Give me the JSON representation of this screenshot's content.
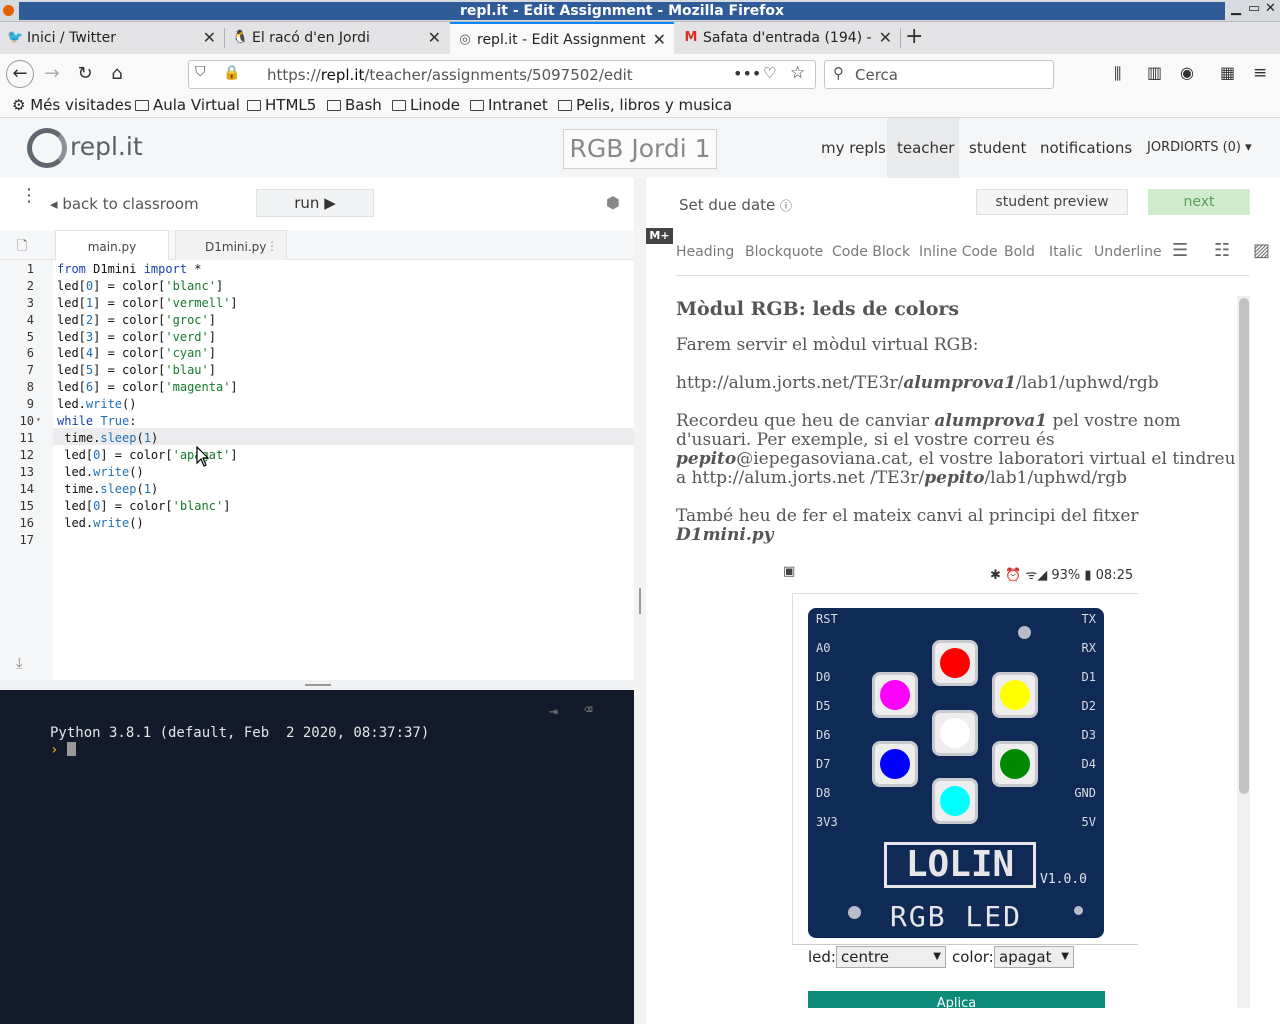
{
  "window": {
    "title": "repl.it - Edit Assignment - Mozilla Firefox"
  },
  "tabs": [
    {
      "label": "Inici / Twitter",
      "icon": "twitter-icon"
    },
    {
      "label": "El racó d'en Jordi",
      "icon": "penguin-icon"
    },
    {
      "label": "repl.it - Edit Assignment",
      "icon": "replit-icon",
      "selected": true
    },
    {
      "label": "Safata d'entrada (194) -",
      "icon": "gmail-icon"
    }
  ],
  "nav": {
    "url_prefix": "https://",
    "url_host": "repl.it",
    "url_path": "/teacher/assignments/5097502/edit",
    "search_placeholder": "Cerca"
  },
  "bookmarks": [
    "Més visitades",
    "Aula Virtual",
    "HTML5",
    "Bash",
    "Linode",
    "Intranet",
    "Pelis, libros y musica"
  ],
  "header": {
    "logo_text": "repl.it",
    "project_name": "RGB Jordi 1",
    "links": [
      "my repls",
      "teacher",
      "student",
      "notifications"
    ],
    "user_menu": "JORDIORTS (0)"
  },
  "editor": {
    "back_label": "back to classroom",
    "run_label": "run ▶",
    "file_tabs": [
      "main.py",
      "D1mini.py"
    ],
    "line_numbers": [
      "1",
      "2",
      "3",
      "4",
      "5",
      "6",
      "7",
      "8",
      "9",
      "10",
      "11",
      "12",
      "13",
      "14",
      "15",
      "16",
      "17"
    ]
  },
  "console": {
    "banner": "Python 3.8.1 (default, Feb  2 2020, 08:37:37)",
    "prompt": "›"
  },
  "assignment": {
    "due_date_label": "Set due date",
    "preview_label": "student preview",
    "next_label": "next",
    "md_badge": "M+",
    "toolbar": [
      "Heading",
      "Blockquote",
      "Code Block",
      "Inline Code",
      "Bold",
      "Italic",
      "Underline"
    ],
    "heading": "Mòdul RGB: leds de colors",
    "p1": "Farem servir el mòdul virtual RGB:",
    "url_a": "http://alum.jorts.net/TE3r/",
    "url_b": "alumprova1",
    "url_c": "/lab1/uphwd/rgb",
    "p3a": "Recordeu que heu de canviar ",
    "p3b": "alumprova1",
    "p3c": " pel vostre nom d'usuari. Per exemple, si el vostre correu és ",
    "p3d": "pepito",
    "p3e": "@iepegasoviana.cat, el vostre laboratori virtual el tindreu a http://alum.jorts.net /TE3r/",
    "p3f": "pepito",
    "p3g": "/lab1/uphwd/rgb",
    "p4a": "També heu de fer el mateix canvi al principi del fitxer ",
    "p4b": "D1mini.py",
    "phone_status": "93% ▮ 08:25",
    "board_brand": "LOLIN",
    "board_version": "V1.0.0",
    "board_label": "RGB LED",
    "pins_left": [
      "RST",
      "A0",
      "D0",
      "D5",
      "D6",
      "D7",
      "D8",
      "3V3"
    ],
    "pins_right": [
      "TX",
      "RX",
      "D1",
      "D2",
      "D3",
      "D4",
      "GND",
      "5V"
    ],
    "led_label": "led:",
    "led_value": "centre",
    "color_label": "color:",
    "color_value": "apagat",
    "apply_label": "Aplica"
  },
  "led_colors": {
    "top": "#ff0000",
    "top_left": "#ff00ff",
    "top_right": "#ffff00",
    "center": "#ffffff",
    "bottom_left": "#0000ff",
    "bottom_right": "#008800",
    "bottom": "#00ffff"
  }
}
